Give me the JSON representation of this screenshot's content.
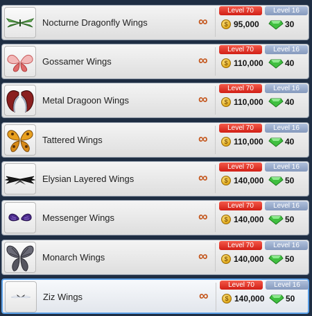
{
  "wings": [
    {
      "name": "Nocturne Dragonfly Wings",
      "unlock_level": "Level 70",
      "alt_level": "Level 16",
      "gold": "95,000",
      "gems": "30",
      "icon": "dragonfly-wings-icon"
    },
    {
      "name": "Gossamer Wings",
      "unlock_level": "Level 70",
      "alt_level": "Level 16",
      "gold": "110,000",
      "gems": "40",
      "icon": "gossamer-wings-icon"
    },
    {
      "name": "Metal Dragoon Wings",
      "unlock_level": "Level 70",
      "alt_level": "Level 16",
      "gold": "110,000",
      "gems": "40",
      "icon": "metal-dragoon-wings-icon"
    },
    {
      "name": "Tattered Wings",
      "unlock_level": "Level 70",
      "alt_level": "Level 16",
      "gold": "110,000",
      "gems": "40",
      "icon": "tattered-wings-icon"
    },
    {
      "name": "Elysian Layered Wings",
      "unlock_level": "Level 70",
      "alt_level": "Level 16",
      "gold": "140,000",
      "gems": "50",
      "icon": "elysian-layered-wings-icon"
    },
    {
      "name": "Messenger Wings",
      "unlock_level": "Level 70",
      "alt_level": "Level 16",
      "gold": "140,000",
      "gems": "50",
      "icon": "messenger-wings-icon"
    },
    {
      "name": "Monarch Wings",
      "unlock_level": "Level 70",
      "alt_level": "Level 16",
      "gold": "140,000",
      "gems": "50",
      "icon": "monarch-wings-icon"
    },
    {
      "name": "Ziz Wings",
      "unlock_level": "Level 70",
      "alt_level": "Level 16",
      "gold": "140,000",
      "gems": "50",
      "icon": "ziz-wings-icon"
    }
  ],
  "duration_symbol": "∞",
  "coin_symbol": "$",
  "selected_index": 7,
  "colors": {
    "level_badge": "#e2332a",
    "alt_badge": "#91a4c6",
    "gem": "#3fbf3f",
    "coin": "#e8b22a",
    "infinity": "#c4561c",
    "selected_border": "#5aa0e8"
  }
}
